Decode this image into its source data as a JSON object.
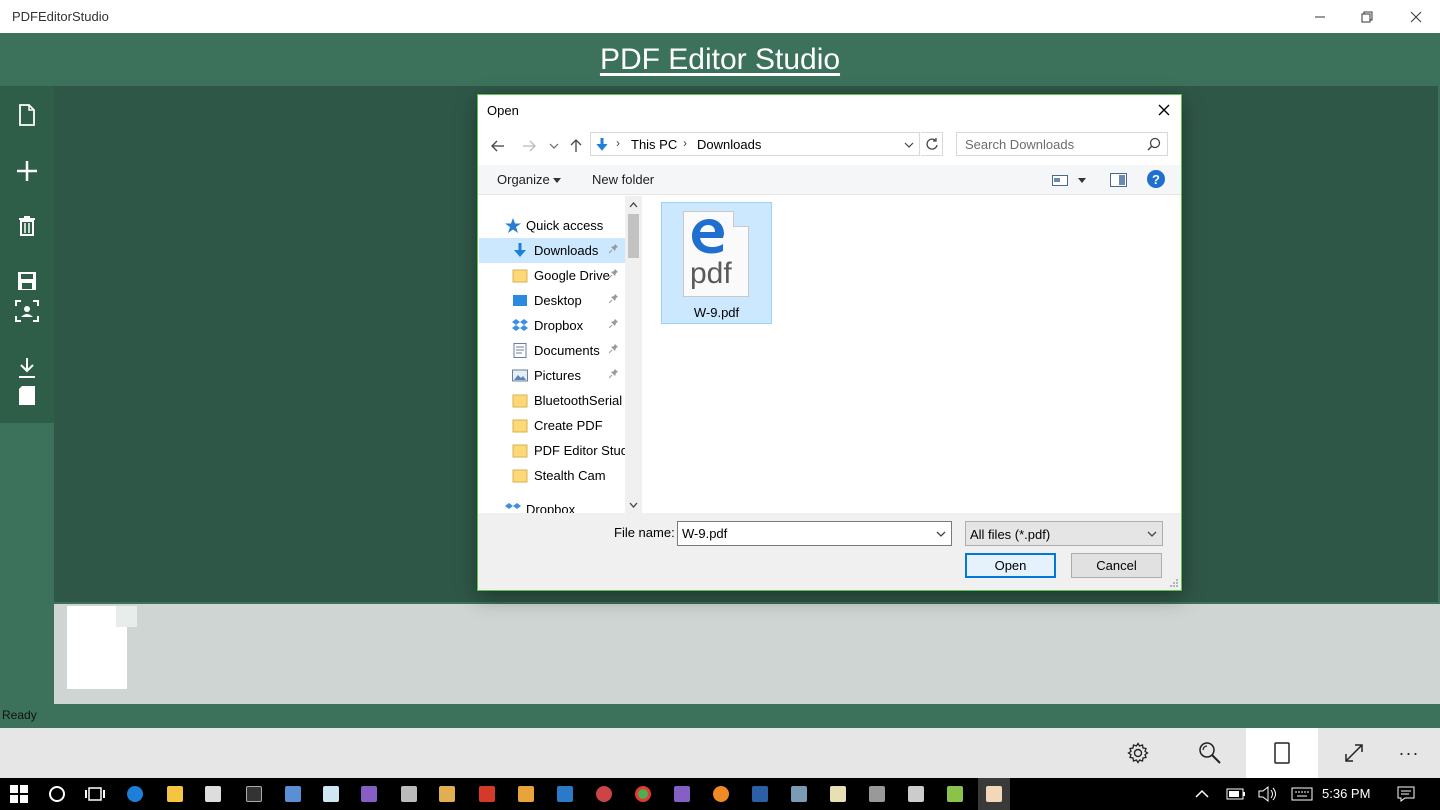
{
  "window": {
    "title": "PDFEditorStudio"
  },
  "app": {
    "heading": "PDF Editor Studio",
    "status": "Ready",
    "left_rail_icons": [
      "new-document-icon",
      "add-icon",
      "delete-icon",
      "save-icon",
      "scan-icon",
      "download-icon",
      "document-icon"
    ],
    "command_bar_icons": [
      "settings-icon",
      "zoom-icon",
      "page-icon",
      "expand-icon",
      "more-icon"
    ],
    "more_label": "···",
    "colors": {
      "header": "#3c725b",
      "main": "#2f5747",
      "strip": "#ced5d2",
      "accent": "#0078d7",
      "selection": "#cce8ff"
    }
  },
  "dialog": {
    "title": "Open",
    "address": {
      "crumbs": [
        "This PC",
        "Downloads"
      ]
    },
    "search": {
      "placeholder": "Search Downloads"
    },
    "toolbar": {
      "organize": "Organize",
      "new_folder": "New folder"
    },
    "nav": {
      "quick_access": "Quick access",
      "items": [
        {
          "label": "Downloads",
          "icon": "downloads-icon",
          "pinned": true,
          "selected": true
        },
        {
          "label": "Google Drive",
          "icon": "folder-icon",
          "pinned": true
        },
        {
          "label": "Desktop",
          "icon": "desktop-icon",
          "pinned": true
        },
        {
          "label": "Dropbox",
          "icon": "dropbox-icon",
          "pinned": true
        },
        {
          "label": "Documents",
          "icon": "documents-icon",
          "pinned": true
        },
        {
          "label": "Pictures",
          "icon": "pictures-icon",
          "pinned": true
        },
        {
          "label": "BluetoothSerial",
          "icon": "folder-icon"
        },
        {
          "label": "Create PDF",
          "icon": "folder-icon"
        },
        {
          "label": "PDF Editor Studi",
          "icon": "folder-icon"
        },
        {
          "label": "Stealth Cam",
          "icon": "folder-icon"
        }
      ],
      "partial_item": "Dropbox"
    },
    "files": [
      {
        "name": "W-9.pdf",
        "badge": "pdf",
        "icon": "edge-pdf-icon"
      }
    ],
    "filename_label": "File name:",
    "filename_value": "W-9.pdf",
    "filter": "All files (*.pdf)",
    "open_label": "Open",
    "cancel_label": "Cancel"
  },
  "taskbar": {
    "time": "5:36 PM",
    "apps": [
      "start-icon",
      "cortana-icon",
      "task-view-icon",
      "edge-icon",
      "file-explorer-icon",
      "store-icon",
      "cmd-icon",
      "box-icon",
      "notes-icon",
      "visual-studio-icon",
      "calculator-icon",
      "paint-icon",
      "app-red-icon",
      "app-grid-icon",
      "app-blue-icon",
      "app-orb-icon",
      "chrome-icon",
      "visual-studio-2-icon",
      "app-orange-icon",
      "powershell-icon",
      "app-gear-icon",
      "app-panel-icon",
      "app-cube-icon",
      "unity-icon",
      "android-icon",
      "pdf-editor-taskbar-icon"
    ]
  }
}
